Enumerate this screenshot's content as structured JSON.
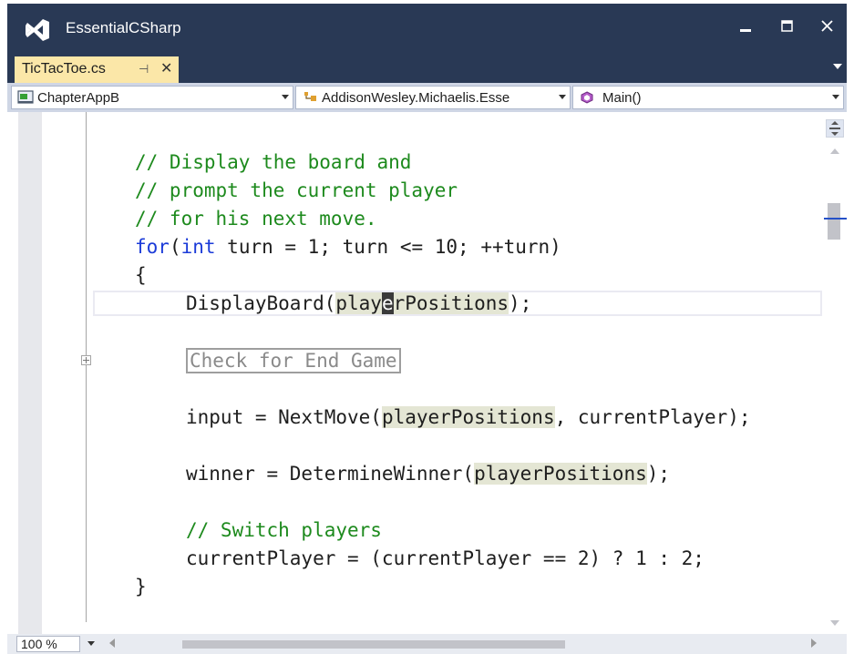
{
  "window": {
    "title": "EssentialCSharp",
    "accent_color": "#293955",
    "tab_color": "#fbe7a8"
  },
  "tab": {
    "label": "TicTacToe.cs",
    "pin_icon": "pin-icon",
    "close_icon": "close-icon"
  },
  "navbar": {
    "project": "ChapterAppB",
    "class": "AddisonWesley.Michaelis.Esse",
    "member": "Main()"
  },
  "code": {
    "l1": "// Display the board and",
    "l2": "// prompt the current player",
    "l3": "// for his next move.",
    "l4_kw1": "for",
    "l4_p1": "(",
    "l4_kw2": "int",
    "l4_p2": " turn = 1; turn <= 10; ++turn)",
    "l5": "{",
    "l6_a": "DisplayBoard(",
    "l6_b": "play",
    "l6_caret": "e",
    "l6_c": "rPositions",
    "l6_d": ");",
    "l7": "Check for End Game",
    "l8_a": "input = NextMove(",
    "l8_b": "playerPositions",
    "l8_c": ", currentPlayer);",
    "l9_a": "winner = DetermineWinner(",
    "l9_b": "playerPositions",
    "l9_c": ");",
    "l10": "// Switch players",
    "l11": "currentPlayer = (currentPlayer == 2) ? 1 : 2;",
    "l12": "}"
  },
  "status": {
    "zoom": "100 %"
  }
}
